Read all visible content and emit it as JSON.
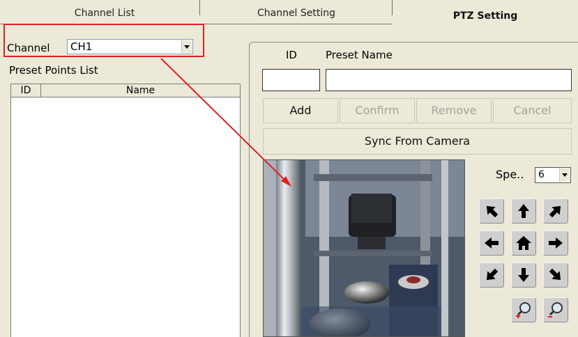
{
  "tabs": [
    {
      "label": "Channel List",
      "active": false
    },
    {
      "label": "Channel Setting",
      "active": false
    },
    {
      "label": "PTZ Setting",
      "active": true
    }
  ],
  "channel": {
    "label": "Channel",
    "value": "CH1"
  },
  "preset_list": {
    "title": "Preset Points List",
    "columns": [
      "ID",
      "Name"
    ],
    "rows": []
  },
  "editor": {
    "id_label": "ID",
    "name_label": "Preset Name",
    "id_value": "",
    "name_value": "",
    "buttons": {
      "add": "Add",
      "confirm": "Confirm",
      "remove": "Remove",
      "cancel": "Cancel"
    },
    "sync_label": "Sync From Camera"
  },
  "speed": {
    "label": "Spe..",
    "value": "6"
  },
  "ptz_icons": [
    "arrow-up-left-icon",
    "arrow-up-icon",
    "arrow-up-right-icon",
    "arrow-left-icon",
    "home-icon",
    "arrow-right-icon",
    "arrow-down-left-icon",
    "arrow-down-icon",
    "arrow-down-right-icon",
    "zoom-in-icon",
    "zoom-out-icon"
  ],
  "colors": {
    "highlight": "#e02020",
    "window": "#ece9d8",
    "ptz_button": "#cfcfcf"
  }
}
